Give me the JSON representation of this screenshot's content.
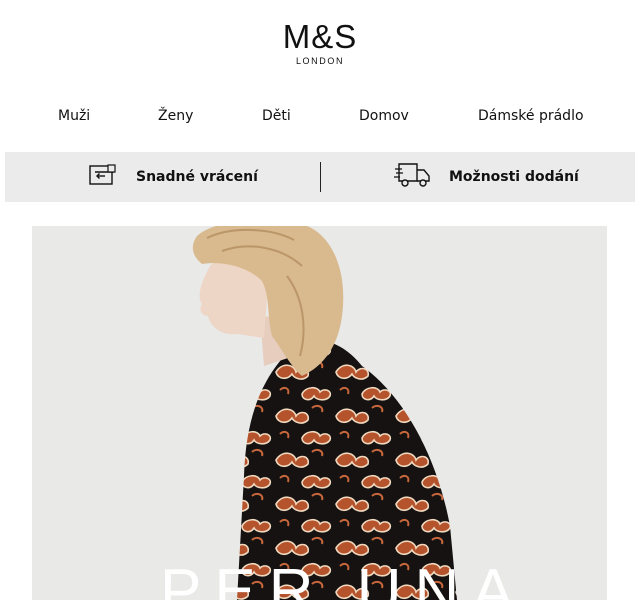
{
  "brand": {
    "name": "M&S",
    "tagline": "LONDON"
  },
  "nav": {
    "items": [
      {
        "label": "Muži"
      },
      {
        "label": "Ženy"
      },
      {
        "label": "Děti"
      },
      {
        "label": "Domov"
      },
      {
        "label": "Dámské prádlo"
      }
    ]
  },
  "service_bar": {
    "returns": {
      "label": "Snadné vrácení",
      "icon": "return-icon"
    },
    "delivery": {
      "label": "Možnosti dodání",
      "icon": "delivery-truck-icon"
    }
  },
  "hero": {
    "title": "PER UNA",
    "colors": {
      "background": "#e9e9e8",
      "hair": "#d9b98e",
      "print_dark": "#151211",
      "print_rust": "#b5532d",
      "print_cream": "#f0d9bf"
    }
  }
}
